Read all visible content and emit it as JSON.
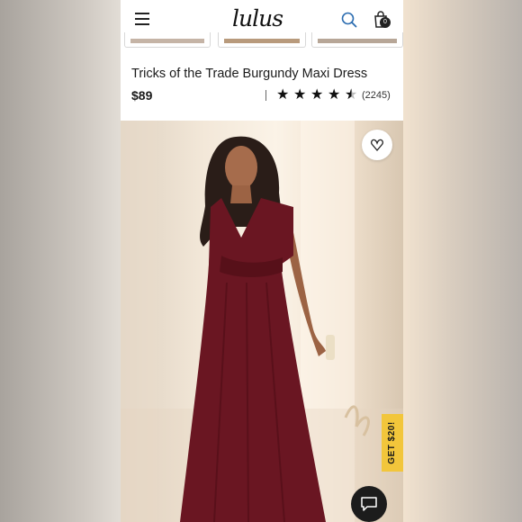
{
  "header": {
    "logo": "lulus",
    "cart_count": "0",
    "menu_icon": "hamburger-menu-icon",
    "search_icon": "search-icon",
    "bag_icon": "shopping-bag-icon"
  },
  "product": {
    "title": "Tricks of the Trade Burgundy Maxi Dress",
    "price": "$89",
    "rating": 4.5,
    "review_count": "(2245)"
  },
  "promo": {
    "label": "GET $20!"
  },
  "colors": {
    "accent_search": "#2b6cb0",
    "promo_bg": "#f2c63b",
    "dress": "#6a1622",
    "chat_bg": "#1c1c1c"
  }
}
